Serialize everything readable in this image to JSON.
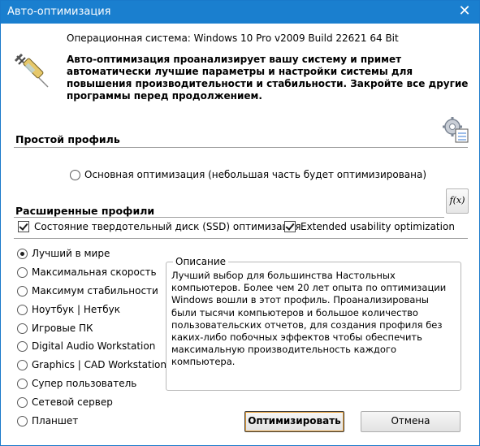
{
  "window": {
    "title": "Авто-оптимизация",
    "close_glyph": "✕"
  },
  "header": {
    "os_line": "Операционная система: Windows 10 Pro v2009 Build 22621 64 Bit",
    "description": "Авто-оптимизация проанализирует вашу систему и примет автоматически лучшие параметры и настройки системы для повышения производительности и стабильности. Закройте все другие программы перед продолжением.",
    "icon": "syringe-icon"
  },
  "simple_profile": {
    "heading": "Простой профиль",
    "option_label": "Основная оптимизация (небольшая часть будет оптимизирована)",
    "icon": "gear-settings-icon"
  },
  "advanced_profiles": {
    "heading": "Расширенные профили",
    "fx_label": "f(x)",
    "checkboxes": [
      {
        "label": "Состояние твердотельный диск (SSD) оптимизация",
        "checked": true
      },
      {
        "label": "Extended usability optimization",
        "checked": true
      }
    ],
    "options": [
      {
        "label": "Лучший в мире",
        "checked": true
      },
      {
        "label": "Максимальная скорость",
        "checked": false
      },
      {
        "label": "Максимум стабильности",
        "checked": false
      },
      {
        "label": "Ноутбук | Нетбук",
        "checked": false
      },
      {
        "label": "Игровые ПК",
        "checked": false
      },
      {
        "label": "Digital Audio Workstation",
        "checked": false
      },
      {
        "label": "Graphics | CAD Workstation",
        "checked": false
      },
      {
        "label": "Супер пользователь",
        "checked": false
      },
      {
        "label": "Сетевой сервер",
        "checked": false
      },
      {
        "label": "Планшет",
        "checked": false
      }
    ]
  },
  "description_box": {
    "legend": "Описание",
    "text": "Лучший выбор для большинства Настольных компьютеров. Более чем 20 лет опыта по оптимизации Windows вошли в этот профиль. Проанализированы были тысячи компьютеров и большое количество пользовательских отчетов, для создания профиля без каких-либо побочных эффектов чтобы обеспечить максимальную производительность каждого компьютера."
  },
  "buttons": {
    "optimize": "Оптимизировать",
    "cancel": "Отмена"
  },
  "colors": {
    "titlebar": "#1a7fcf",
    "button_focus": "#e8a13a"
  }
}
